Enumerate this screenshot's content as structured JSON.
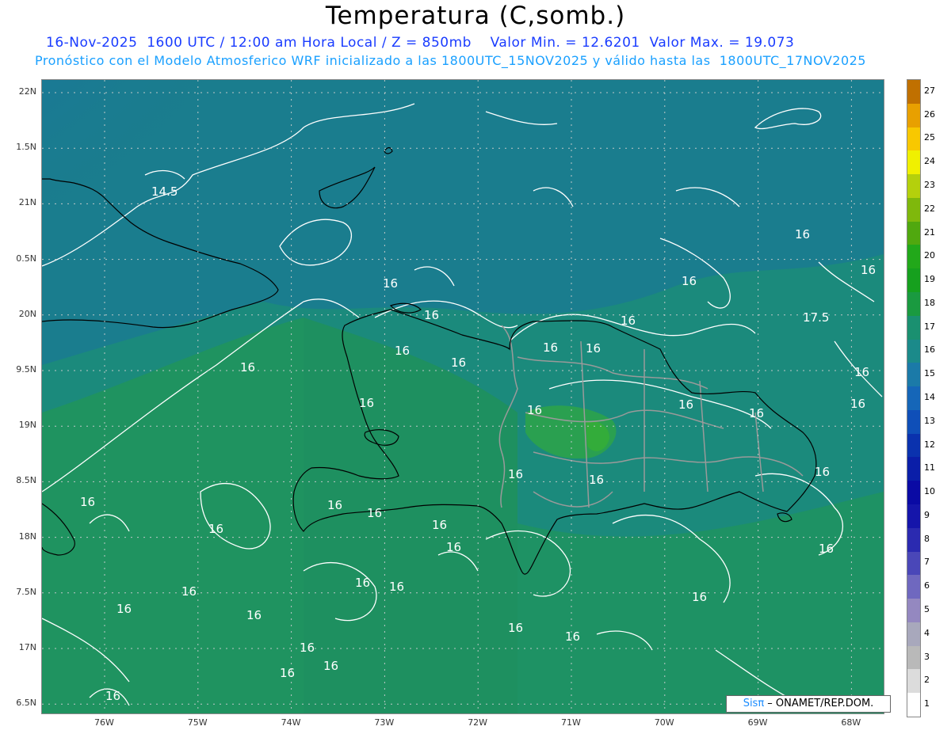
{
  "title": "Temperatura (C,somb.)",
  "subtitle_line1": "16-Nov-2025  1600 UTC / 12:00 am Hora Local / Z = 850mb    Valor Min. = 12.6201  Valor Max. = 19.073",
  "subtitle_line2": "Pronóstico con el Modelo Atmosferico WRF inicializado a las 1800UTC_15NOV2025 y válido hasta las  1800UTC_17NOV2025",
  "colors": {
    "title": "#000000",
    "subtitle_line1": "#1a3cff",
    "subtitle_line2": "#1aa0ff",
    "field_16": "#1b8a7a",
    "field_17": "#1f9458",
    "field_15": "#1a7a8e",
    "contour": "#ffffff",
    "coast": "#000000",
    "border": "#999999"
  },
  "map": {
    "lat_labels": [
      "22N",
      "1.5N",
      "21N",
      "0.5N",
      "20N",
      "9.5N",
      "19N",
      "8.5N",
      "18N",
      "7.5N",
      "17N",
      "6.5N"
    ],
    "lon_labels": [
      "76W",
      "75W",
      "74W",
      "73W",
      "72W",
      "71W",
      "70W",
      "69W",
      "68W"
    ],
    "contour_labels": [
      "14.5",
      "16",
      "16",
      "16",
      "16",
      "16",
      "16",
      "16",
      "16",
      "16",
      "16",
      "16",
      "16",
      "16",
      "16",
      "17.5",
      "16",
      "16",
      "16",
      "16",
      "16",
      "16",
      "16",
      "16",
      "16",
      "16",
      "16",
      "16",
      "16",
      "16",
      "16",
      "16",
      "16",
      "16",
      "16",
      "16",
      "16",
      "16",
      "16",
      "16",
      "16"
    ],
    "min_value": 12.6201,
    "max_value": 19.073
  },
  "legend": {
    "labels": [
      "1",
      "2",
      "3",
      "4",
      "5",
      "6",
      "7",
      "8",
      "9",
      "10",
      "11",
      "12",
      "13",
      "14",
      "15",
      "16",
      "17",
      "18",
      "19",
      "20",
      "21",
      "22",
      "23",
      "24",
      "25",
      "26",
      "27"
    ],
    "colors": [
      "#ffffff",
      "#dcdcdc",
      "#b9b9b9",
      "#a8a8bc",
      "#9488c0",
      "#6f68bf",
      "#4a47b8",
      "#2b2ab0",
      "#1515aa",
      "#0a0aa4",
      "#0a1ea8",
      "#0a32ae",
      "#0f4fb8",
      "#1566b8",
      "#1b7aa8",
      "#1b8a8a",
      "#1a9070",
      "#1a9a40",
      "#16a01e",
      "#22a81a",
      "#50a80f",
      "#7fb80c",
      "#b4d00c",
      "#f0f000",
      "#f8c800",
      "#e8a000",
      "#c07000"
    ]
  },
  "credit": {
    "logo": "Sisπ",
    "text": " – ONAMET/REP.DOM."
  }
}
